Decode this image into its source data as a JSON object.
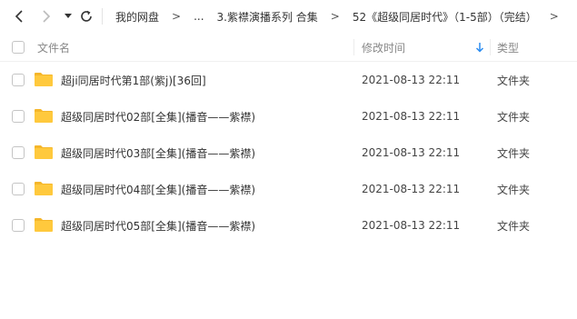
{
  "toolbar": {
    "back_icon": "chevron-left-icon",
    "forward_icon": "chevron-right-icon",
    "history_icon": "caret-down-icon",
    "refresh_icon": "refresh-icon"
  },
  "breadcrumbs": [
    {
      "label": "我的网盘"
    },
    {
      "label": "..."
    },
    {
      "label": "3.紫襟演播系列 合集"
    },
    {
      "label": "52《超级同居时代》（1-5部）（完结）"
    }
  ],
  "chevron": ">",
  "header": {
    "name": "文件名",
    "modified": "修改时间",
    "type": "类型",
    "sort_icon": "sort-down-arrow-icon",
    "sort_color": "#2b8cf0"
  },
  "files": [
    {
      "name": "超ji同居时代第1部(紫j)[36回]",
      "modified": "2021-08-13 22:11",
      "type": "文件夹"
    },
    {
      "name": "超级同居时代02部[全集](播音——紫襟)",
      "modified": "2021-08-13 22:11",
      "type": "文件夹"
    },
    {
      "name": "超级同居时代03部[全集](播音——紫襟)",
      "modified": "2021-08-13 22:11",
      "type": "文件夹"
    },
    {
      "name": "超级同居时代04部[全集](播音——紫襟)",
      "modified": "2021-08-13 22:11",
      "type": "文件夹"
    },
    {
      "name": "超级同居时代05部[全集](播音——紫襟)",
      "modified": "2021-08-13 22:11",
      "type": "文件夹"
    }
  ],
  "colors": {
    "folder": "#ffc93d",
    "folder_tab": "#f5b62a"
  }
}
